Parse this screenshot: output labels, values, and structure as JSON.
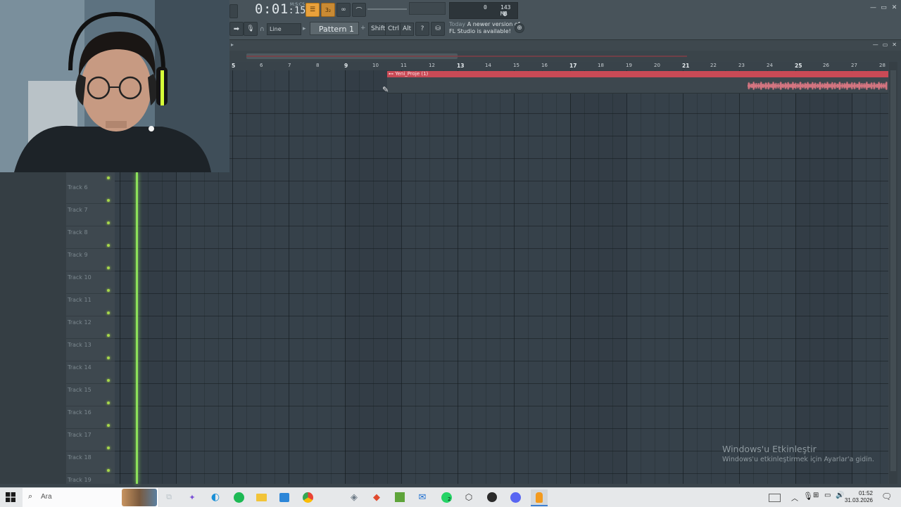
{
  "toolbar": {
    "time_main": "0:01",
    "time_sub": "15",
    "time_unit": "M:S:CS",
    "snap_mode": "Line",
    "pattern": "Pattern 1",
    "shift_label": "Shift",
    "ctrl_label": "Ctrl",
    "alt_label": "Alt",
    "cpu_value": "0",
    "ram_value": "143 MB",
    "poly_value": "0",
    "news_day": "Today",
    "news_line1": "A newer version of",
    "news_line2": "FL Studio is available!"
  },
  "playlist": {
    "bar_numbers": [
      "5",
      "6",
      "7",
      "8",
      "9",
      "10",
      "11",
      "12",
      "13",
      "14",
      "15",
      "16",
      "17",
      "18",
      "19",
      "20",
      "21",
      "22",
      "23",
      "24",
      "25",
      "26",
      "27",
      "28"
    ],
    "major_bars": [
      "5",
      "9",
      "13",
      "17",
      "21",
      "25"
    ],
    "clip_name": "Yeni_Proje (1)",
    "tracks": [
      "Track 6",
      "Track 7",
      "Track 8",
      "Track 9",
      "Track 10",
      "Track 11",
      "Track 12",
      "Track 13",
      "Track 14",
      "Track 15",
      "Track 16",
      "Track 17",
      "Track 18",
      "Track 19"
    ]
  },
  "watermark": {
    "title": "Windows'u Etkinleştir",
    "subtitle": "Windows'u etkinleştirmek için Ayarlar'a gidin."
  },
  "taskbar": {
    "search_placeholder": "Ara",
    "time": "01:52",
    "date": "31.03.2026",
    "whatsapp_badge": "2",
    "icons": [
      "windows-start-icon",
      "search-icon",
      "task-view-icon",
      "copilot-icon",
      "edge-icon",
      "spotify-icon",
      "file-explorer-icon",
      "store-icon",
      "chrome-icon",
      "app-icon",
      "app2-icon",
      "minecraft-icon",
      "mail-icon",
      "whatsapp-icon",
      "unity-icon",
      "obs-icon",
      "discord-icon",
      "fl-studio-icon"
    ]
  },
  "colors": {
    "accent": "#e9a13b",
    "clip": "#c94a56",
    "playhead": "#8ce05a",
    "track_led": "#a7d84a"
  }
}
